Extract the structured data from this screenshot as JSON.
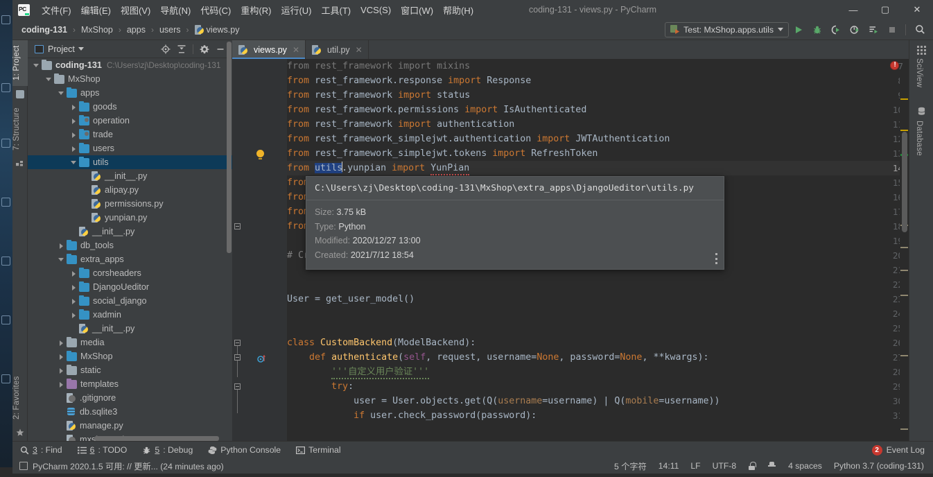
{
  "window": {
    "title": "coding-131 - views.py - PyCharm",
    "app_logo": "pycharm-logo",
    "controls": {
      "minimize": "—",
      "maximize": "▢",
      "close": "✕"
    }
  },
  "menubar": {
    "items": [
      {
        "label": "文件(F)",
        "name": "menu-file"
      },
      {
        "label": "编辑(E)",
        "name": "menu-edit"
      },
      {
        "label": "视图(V)",
        "name": "menu-view"
      },
      {
        "label": "导航(N)",
        "name": "menu-navigate"
      },
      {
        "label": "代码(C)",
        "name": "menu-code"
      },
      {
        "label": "重构(R)",
        "name": "menu-refactor"
      },
      {
        "label": "运行(U)",
        "name": "menu-run"
      },
      {
        "label": "工具(T)",
        "name": "menu-tools"
      },
      {
        "label": "VCS(S)",
        "name": "menu-vcs"
      },
      {
        "label": "窗口(W)",
        "name": "menu-window"
      },
      {
        "label": "帮助(H)",
        "name": "menu-help"
      }
    ]
  },
  "navbar": {
    "breadcrumbs": [
      {
        "label": "coding-131",
        "bold": true
      },
      {
        "label": "MxShop",
        "bold": false
      },
      {
        "label": "apps",
        "bold": false
      },
      {
        "label": "users",
        "bold": false
      },
      {
        "label": "views.py",
        "bold": false,
        "icon": "python-file-icon"
      }
    ],
    "separator": "›",
    "run_config": "Test: MxShop.apps.utils",
    "toolbar_buttons": [
      {
        "name": "run-button",
        "label": "Run"
      },
      {
        "name": "debug-button",
        "label": "Debug"
      },
      {
        "name": "run-coverage-button",
        "label": "Run with Coverage"
      },
      {
        "name": "profile-button",
        "label": "Profile"
      },
      {
        "name": "run-with-console-button",
        "label": "Run with Console"
      },
      {
        "name": "stop-button",
        "label": "Stop"
      },
      {
        "name": "search-everywhere-button",
        "label": "Search"
      }
    ]
  },
  "left_strip": {
    "tabs": [
      {
        "label": "1: Project",
        "selected": true,
        "icon": "project-icon"
      },
      {
        "label": "7: Structure",
        "selected": false,
        "icon": "structure-icon"
      },
      {
        "label": "2: Favorites",
        "selected": false,
        "icon": "star-icon"
      }
    ]
  },
  "right_strip": {
    "tabs": [
      {
        "label": "SciView",
        "icon": "grid-icon"
      },
      {
        "label": "Database",
        "icon": "database-icon"
      }
    ]
  },
  "project_panel": {
    "title": "Project",
    "toolbar": [
      {
        "name": "select-opened-file-button",
        "label": "Select Opened File"
      },
      {
        "name": "collapse-all-button",
        "label": "Collapse All"
      },
      {
        "name": "settings-gear-button",
        "label": "Settings"
      },
      {
        "name": "hide-panel-button",
        "label": "Hide"
      }
    ],
    "tree": [
      {
        "label": "coding-131",
        "path": "C:\\Users\\zj\\Desktop\\coding-131",
        "indent": 0,
        "arrow": "down",
        "icon": "folder-gray",
        "bold": true,
        "selected": false
      },
      {
        "label": "MxShop",
        "path": "",
        "indent": 1,
        "arrow": "down",
        "icon": "folder-gray",
        "bold": false,
        "selected": false
      },
      {
        "label": "apps",
        "path": "",
        "indent": 2,
        "arrow": "down",
        "icon": "folder-blue",
        "bold": false,
        "selected": false
      },
      {
        "label": "goods",
        "path": "",
        "indent": 3,
        "arrow": "right",
        "icon": "folder-blue",
        "bold": false,
        "selected": false
      },
      {
        "label": "operation",
        "path": "",
        "indent": 3,
        "arrow": "right",
        "icon": "folder-blue-mod",
        "bold": false,
        "selected": false
      },
      {
        "label": "trade",
        "path": "",
        "indent": 3,
        "arrow": "right",
        "icon": "folder-blue-mod",
        "bold": false,
        "selected": false
      },
      {
        "label": "users",
        "path": "",
        "indent": 3,
        "arrow": "right",
        "icon": "folder-blue",
        "bold": false,
        "selected": false
      },
      {
        "label": "utils",
        "path": "",
        "indent": 3,
        "arrow": "down",
        "icon": "folder-blue",
        "bold": false,
        "selected": true
      },
      {
        "label": "__init__.py",
        "path": "",
        "indent": 4,
        "arrow": "none",
        "icon": "python-file",
        "bold": false,
        "selected": false
      },
      {
        "label": "alipay.py",
        "path": "",
        "indent": 4,
        "arrow": "none",
        "icon": "python-file",
        "bold": false,
        "selected": false
      },
      {
        "label": "permissions.py",
        "path": "",
        "indent": 4,
        "arrow": "none",
        "icon": "python-file",
        "bold": false,
        "selected": false
      },
      {
        "label": "yunpian.py",
        "path": "",
        "indent": 4,
        "arrow": "none",
        "icon": "python-file",
        "bold": false,
        "selected": false
      },
      {
        "label": "__init__.py",
        "path": "",
        "indent": 3,
        "arrow": "none",
        "icon": "python-file",
        "bold": false,
        "selected": false
      },
      {
        "label": "db_tools",
        "path": "",
        "indent": 2,
        "arrow": "right",
        "icon": "folder-blue",
        "bold": false,
        "selected": false
      },
      {
        "label": "extra_apps",
        "path": "",
        "indent": 2,
        "arrow": "down",
        "icon": "folder-blue",
        "bold": false,
        "selected": false
      },
      {
        "label": "corsheaders",
        "path": "",
        "indent": 3,
        "arrow": "right",
        "icon": "folder-blue",
        "bold": false,
        "selected": false
      },
      {
        "label": "DjangoUeditor",
        "path": "",
        "indent": 3,
        "arrow": "right",
        "icon": "folder-blue",
        "bold": false,
        "selected": false
      },
      {
        "label": "social_django",
        "path": "",
        "indent": 3,
        "arrow": "right",
        "icon": "folder-blue",
        "bold": false,
        "selected": false
      },
      {
        "label": "xadmin",
        "path": "",
        "indent": 3,
        "arrow": "right",
        "icon": "folder-blue",
        "bold": false,
        "selected": false
      },
      {
        "label": "__init__.py",
        "path": "",
        "indent": 3,
        "arrow": "none",
        "icon": "python-file",
        "bold": false,
        "selected": false
      },
      {
        "label": "media",
        "path": "",
        "indent": 2,
        "arrow": "right",
        "icon": "folder-gray",
        "bold": false,
        "selected": false
      },
      {
        "label": "MxShop",
        "path": "",
        "indent": 2,
        "arrow": "right",
        "icon": "folder-blue",
        "bold": false,
        "selected": false
      },
      {
        "label": "static",
        "path": "",
        "indent": 2,
        "arrow": "right",
        "icon": "folder-gray",
        "bold": false,
        "selected": false
      },
      {
        "label": "templates",
        "path": "",
        "indent": 2,
        "arrow": "right",
        "icon": "folder-purple",
        "bold": false,
        "selected": false
      },
      {
        "label": ".gitignore",
        "path": "",
        "indent": 2,
        "arrow": "none",
        "icon": "gitignore-file",
        "bold": false,
        "selected": false
      },
      {
        "label": "db.sqlite3",
        "path": "",
        "indent": 2,
        "arrow": "none",
        "icon": "database-file",
        "bold": false,
        "selected": false
      },
      {
        "label": "manage.py",
        "path": "",
        "indent": 2,
        "arrow": "none",
        "icon": "python-file",
        "bold": false,
        "selected": false
      },
      {
        "label": "mxshop.sql",
        "path": "",
        "indent": 2,
        "arrow": "none",
        "icon": "sql-file",
        "bold": false,
        "selected": false
      }
    ]
  },
  "editor": {
    "tabs": [
      {
        "label": "views.py",
        "active": true,
        "icon": "python-file-icon",
        "close": "✕"
      },
      {
        "label": "util.py",
        "active": false,
        "icon": "python-file-icon",
        "close": "✕"
      }
    ],
    "first_line": 7,
    "current_line": 14,
    "lines": [
      {
        "n": 7,
        "t": "from rest_framework import mixins",
        "style": "unused"
      },
      {
        "n": 8,
        "t": "from rest_framework.response import Response",
        "style": "import"
      },
      {
        "n": 9,
        "t": "from rest_framework import status",
        "style": "import"
      },
      {
        "n": 10,
        "t": "from rest_framework.permissions import IsAuthenticated",
        "style": "import"
      },
      {
        "n": 11,
        "t": "from rest_framework import authentication",
        "style": "import"
      },
      {
        "n": 12,
        "t": "from rest_framework_simplejwt.authentication import JWTAuthentication",
        "style": "import"
      },
      {
        "n": 13,
        "t": "from rest_framework_simplejwt.tokens import RefreshToken",
        "style": "import"
      },
      {
        "n": 14,
        "t": "from utils.yunpian import YunPian",
        "style": "import-selected"
      },
      {
        "n": 15,
        "t": "from",
        "style": "import"
      },
      {
        "n": 16,
        "t": "from",
        "style": "import"
      },
      {
        "n": 17,
        "t": "from",
        "style": "import"
      },
      {
        "n": 18,
        "t": "from",
        "style": "import"
      },
      {
        "n": 19,
        "t": "",
        "style": "blank"
      },
      {
        "n": 20,
        "t": "# Cre",
        "style": "comment"
      },
      {
        "n": 21,
        "t": "",
        "style": "blank"
      },
      {
        "n": 22,
        "t": "",
        "style": "blank"
      },
      {
        "n": 23,
        "t": "User = get_user_model()",
        "style": "code"
      },
      {
        "n": 24,
        "t": "",
        "style": "blank"
      },
      {
        "n": 25,
        "t": "",
        "style": "blank"
      },
      {
        "n": 26,
        "t": "class CustomBackend(ModelBackend):",
        "style": "class"
      },
      {
        "n": 27,
        "t": "    def authenticate(self, request, username=None, password=None, **kwargs):",
        "style": "def"
      },
      {
        "n": 28,
        "t": "        '''自定义用户验证'''",
        "style": "docstring"
      },
      {
        "n": 29,
        "t": "        try:",
        "style": "code"
      },
      {
        "n": 30,
        "t": "            user = User.objects.get(Q(username=username) | Q(mobile=username))",
        "style": "code"
      },
      {
        "n": 31,
        "t": "            if user.check_password(password):",
        "style": "code"
      }
    ],
    "selected_token": "utils",
    "error_count_badge": "!"
  },
  "tooltip": {
    "path": "C:\\Users\\zj\\Desktop\\coding-131\\MxShop\\extra_apps\\DjangoUeditor\\utils.py",
    "rows": [
      {
        "label": "Size:",
        "value": "3.75 kB"
      },
      {
        "label": "Type:",
        "value": "Python"
      },
      {
        "label": "Modified:",
        "value": "2020/12/27 13:00"
      },
      {
        "label": "Created:",
        "value": "2021/7/12 18:54"
      }
    ],
    "more_button": "⋮"
  },
  "bottom_bar": {
    "tools": [
      {
        "num": "3",
        "label": ": Find",
        "icon": "search-icon",
        "name": "tool-find"
      },
      {
        "num": "6",
        "label": ": TODO",
        "icon": "list-icon",
        "name": "tool-todo"
      },
      {
        "num": "5",
        "label": ": Debug",
        "icon": "bug-icon",
        "name": "tool-debug"
      },
      {
        "num": "",
        "label": "Python Console",
        "icon": "python-icon",
        "name": "tool-python-console"
      },
      {
        "num": "",
        "label": "Terminal",
        "icon": "terminal-icon",
        "name": "tool-terminal"
      }
    ],
    "event_log": {
      "label": "Event Log",
      "count": "2"
    }
  },
  "status_bar": {
    "message": "PyCharm 2020.1.5 可用: // 更新... (24 minutes ago)",
    "items": [
      {
        "name": "char-count",
        "label": "5 个字符"
      },
      {
        "name": "caret-position",
        "label": "14:11"
      },
      {
        "name": "line-separator",
        "label": "LF"
      },
      {
        "name": "file-encoding",
        "label": "UTF-8"
      },
      {
        "name": "lock-icon",
        "label": ""
      },
      {
        "name": "hat-icon",
        "label": ""
      },
      {
        "name": "indent-setting",
        "label": "4 spaces"
      },
      {
        "name": "python-interpreter",
        "label": "Python 3.7 (coding-131)"
      }
    ]
  },
  "colors": {
    "bg_panel": "#3c3f41",
    "bg_editor": "#2b2b2b",
    "bg_gutter": "#313335",
    "accent_blue": "#4a88c7",
    "selection_blue": "#214283",
    "tree_selection": "#0d3a58",
    "keyword_orange": "#cc7832",
    "string_green": "#6a8759",
    "function_yellow": "#ffc66d",
    "number_blue": "#6897bb",
    "error_red": "#c7382f",
    "folder_blue": "#3592c4",
    "folder_purple": "#9876aa",
    "run_green": "#59a869"
  }
}
